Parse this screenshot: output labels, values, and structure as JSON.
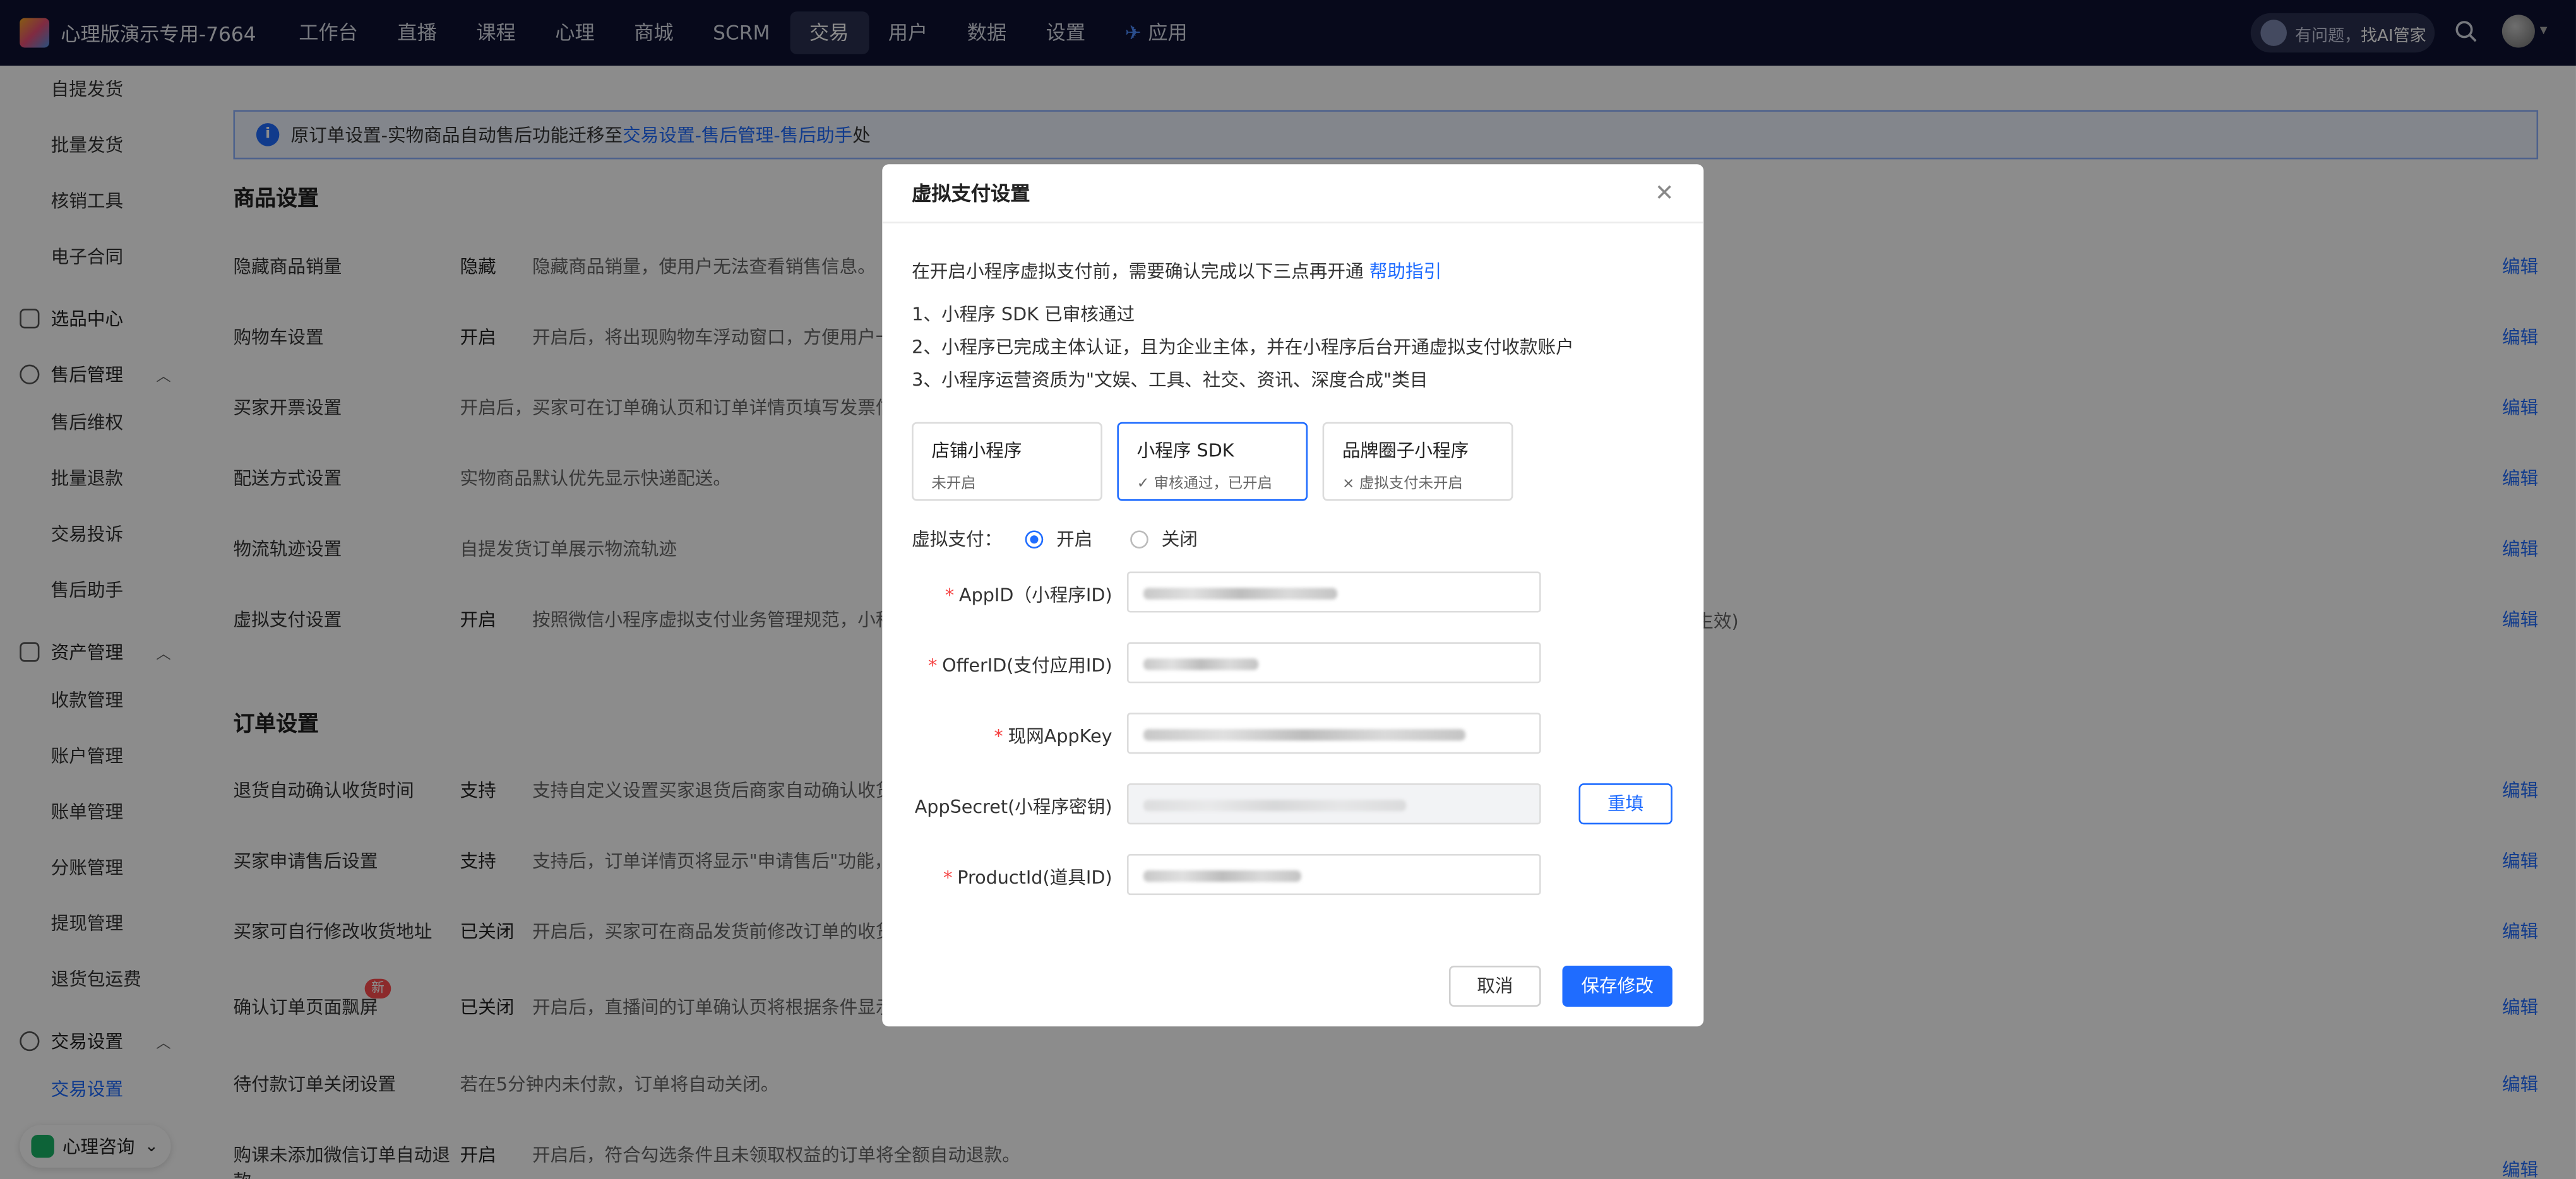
{
  "topbar": {
    "shop_name": "心理版演示专用-7664",
    "nav": [
      "工作台",
      "直播",
      "课程",
      "心理",
      "商城",
      "SCRM",
      "交易",
      "用户",
      "数据",
      "设置"
    ],
    "nav_active": "交易",
    "app_label": "应用",
    "ai_prefix": "有问题，",
    "ai_strong": "找AI管家"
  },
  "sidebar": {
    "items_top": [
      "自提发货",
      "批量发货",
      "核销工具",
      "电子合同"
    ],
    "group_xuanpin": "选品中心",
    "group_shouhou": "售后管理",
    "items_shouhou": [
      "售后维权",
      "批量退款",
      "交易投诉",
      "售后助手"
    ],
    "group_zichan": "资产管理",
    "items_zichan": [
      "收款管理",
      "账户管理",
      "账单管理",
      "分账管理",
      "提现管理",
      "退货包运费"
    ],
    "group_jiaoyi": "交易设置",
    "item_active": "交易设置",
    "bottom_chip": "心理咨询"
  },
  "notice": {
    "text": "原订单设置-实物商品自动售后功能迁移至 ",
    "link": "交易设置-售后管理-售后助手",
    "suffix": " 处"
  },
  "goods_section": {
    "title": "商品设置",
    "rows": [
      {
        "label": "隐藏商品销量",
        "value": "隐藏",
        "desc": "隐藏商品销量，使用户无法查看销售信息。",
        "edit": "编辑"
      },
      {
        "label": "购物车设置",
        "value": "开启",
        "desc": "开启后，将出现购物车浮动窗口，方便用户一",
        "edit": "编辑"
      },
      {
        "label": "买家开票设置",
        "value": "",
        "desc": "开启后，买家可在订单确认页和订单详情页填写发票信",
        "edit": "编辑"
      },
      {
        "label": "配送方式设置",
        "value": "",
        "desc": "实物商品默认优先显示快递配送。",
        "edit": "编辑"
      },
      {
        "label": "物流轨迹设置",
        "value": "",
        "desc": "自提发货订单展示物流轨迹",
        "edit": "编辑"
      },
      {
        "label": "虚拟支付设置",
        "value": "开启",
        "desc": "按照微信小程序虚拟支付业务管理规范，小程",
        "edit": "编辑"
      }
    ],
    "tail_note": "生效)"
  },
  "order_section": {
    "title": "订单设置",
    "rows": [
      {
        "label": "退货自动确认收货时间",
        "value": "支持",
        "desc": "支持自定义设置买家退货后商家自动确认收货",
        "edit": "编辑"
      },
      {
        "label": "买家申请售后设置",
        "value": "支持",
        "desc": "支持后，订单详情页将显示\"申请售后\"功能，",
        "edit": "编辑"
      },
      {
        "label": "买家可自行修改收货地址",
        "value": "已关闭",
        "desc": "开启后，买家可在商品发货前修改订单的收货",
        "edit": "编辑"
      },
      {
        "label": "确认订单页面飘屏",
        "value": "已关闭",
        "desc": "开启后，直播间的订单确认页将根据条件显示",
        "edit": "编辑",
        "badge": "新"
      },
      {
        "label": "待付款订单关闭设置",
        "value": "",
        "desc": "若在5分钟内未付款，订单将自动关闭。",
        "edit": "编辑"
      },
      {
        "label": "购课未添加微信订单自动退",
        "label2": "款",
        "value": "开启",
        "desc": "开启后，符合勾选条件且未领取权益的订单将全额自动退款。",
        "edit": "编辑"
      }
    ]
  },
  "modal": {
    "title": "虚拟支付设置",
    "intro": "在开启小程序虚拟支付前，需要确认完成以下三点再开通 ",
    "help_link": "帮助指引",
    "steps": [
      "1、小程序 SDK 已审核通过",
      "2、小程序已完成主体认证，且为企业主体，并在小程序后台开通虚拟支付收款账户",
      "3、小程序运营资质为\"文娱、工具、社交、资讯、深度合成\"类目"
    ],
    "cards": [
      {
        "title": "店铺小程序",
        "status": "未开启"
      },
      {
        "title": "小程序 SDK",
        "status": "✓ 审核通过，已开启"
      },
      {
        "title": "品牌圈子小程序",
        "status": "× 虚拟支付未开启"
      }
    ],
    "vp_label": "虚拟支付：",
    "vp_on": "开启",
    "vp_off": "关闭",
    "fields": [
      {
        "label": "AppID（小程序ID)",
        "required": true
      },
      {
        "label": "OfferID(支付应用ID)",
        "required": true
      },
      {
        "label": "现网AppKey",
        "required": true
      },
      {
        "label": "AppSecret(小程序密钥)",
        "required": false
      },
      {
        "label": "ProductId(道具ID)",
        "required": true
      }
    ],
    "refill": "重填",
    "cancel": "取消",
    "save": "保存修改"
  }
}
